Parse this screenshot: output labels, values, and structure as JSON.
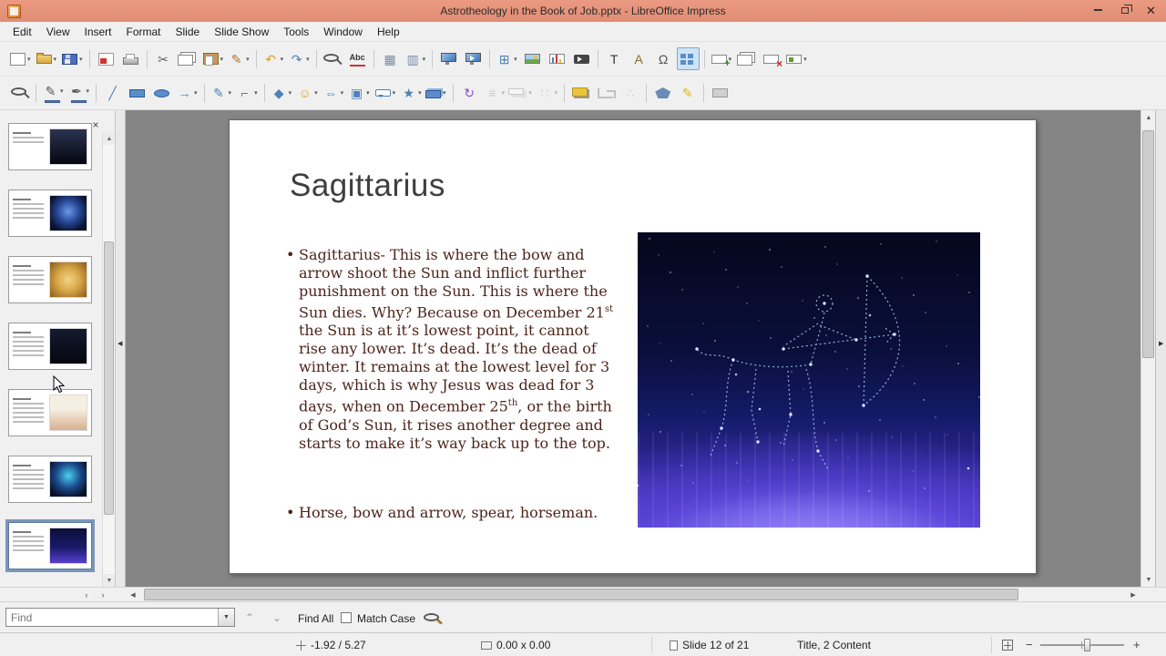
{
  "window": {
    "title": "Astrotheology in the Book of Job.pptx - LibreOffice Impress"
  },
  "menu": {
    "items": [
      "Edit",
      "View",
      "Insert",
      "Format",
      "Slide",
      "Slide Show",
      "Tools",
      "Window",
      "Help"
    ]
  },
  "toolbar1": [
    {
      "n": "new-document",
      "cls": "sh-doc",
      "dd": true
    },
    {
      "n": "open-document",
      "cls": "sh-folder",
      "dd": true
    },
    {
      "n": "save",
      "cls": "sh-floppy",
      "dd": true
    },
    {
      "sep": true
    },
    {
      "n": "export-as-pdf",
      "cls": "sh-pdf"
    },
    {
      "n": "print",
      "cls": "sh-printer"
    },
    {
      "sep": true
    },
    {
      "n": "cut",
      "g": "✂",
      "c": "#666"
    },
    {
      "n": "copy",
      "cls": "sh-copy"
    },
    {
      "n": "paste",
      "cls": "sh-paste",
      "dd": true
    },
    {
      "n": "clone-formatting",
      "g": "✎",
      "c": "#b8742a",
      "dd": true
    },
    {
      "sep": true
    },
    {
      "n": "undo",
      "g": "↶",
      "c": "#d89c2a",
      "dd": true
    },
    {
      "n": "redo",
      "g": "↷",
      "c": "#4d82b8",
      "dd": true
    },
    {
      "sep": true
    },
    {
      "n": "find-and-replace",
      "cls": "sh-zoom"
    },
    {
      "n": "spelling",
      "cls": "sh-spell"
    },
    {
      "sep": true
    },
    {
      "n": "display-grid",
      "g": "▦",
      "c": "#7a8aa8"
    },
    {
      "n": "snap-lines",
      "g": "▥",
      "c": "#7a8aa8",
      "dd": true
    },
    {
      "sep": true
    },
    {
      "n": "start-from-first-slide",
      "cls": "sh-monitor"
    },
    {
      "n": "start-from-current-slide",
      "cls": "sh-monitor2"
    },
    {
      "sep": true
    },
    {
      "n": "insert-table",
      "g": "⊞",
      "c": "#4d82b8",
      "dd": true
    },
    {
      "n": "insert-image",
      "cls": "sh-image"
    },
    {
      "n": "insert-chart",
      "cls": "sh-chart"
    },
    {
      "n": "insert-media",
      "cls": "sh-media"
    },
    {
      "sep": true
    },
    {
      "n": "insert-text-box",
      "g": "T",
      "c": "#333"
    },
    {
      "n": "insert-fontwork",
      "g": "A",
      "c": "#8a6a2a"
    },
    {
      "n": "insert-special-character",
      "g": "Ω",
      "c": "#555"
    },
    {
      "n": "display-views",
      "cls": "sh-views",
      "act": true
    },
    {
      "sep": true
    },
    {
      "n": "new-slide",
      "cls": "sh-slide-plus",
      "dd": true
    },
    {
      "n": "duplicate-slide",
      "cls": "sh-copy"
    },
    {
      "n": "delete-slide",
      "cls": "sh-slide-del"
    },
    {
      "n": "slide-properties",
      "cls": "sh-layout",
      "dd": true
    }
  ],
  "toolbar2": [
    {
      "n": "zoom",
      "cls": "sh-zoom"
    },
    {
      "sep": true
    },
    {
      "n": "line-color",
      "g": "✎",
      "c": "#555",
      "bar": "#4a78c8",
      "dd": true
    },
    {
      "n": "fill-color",
      "g": "✒",
      "c": "#555",
      "bar": "#4a78c8",
      "dd": true
    },
    {
      "sep": true
    },
    {
      "n": "insert-line",
      "g": "╱",
      "c": "#4d82b8"
    },
    {
      "n": "rectangle",
      "cls": "sh-rect"
    },
    {
      "n": "ellipse",
      "cls": "sh-ellipse"
    },
    {
      "n": "lines-and-arrows",
      "g": "→",
      "c": "#4d82b8",
      "dd": true
    },
    {
      "sep": true
    },
    {
      "n": "curves-and-polygons",
      "g": "✎",
      "c": "#4d82b8",
      "dd": true
    },
    {
      "n": "connectors",
      "g": "⌐",
      "c": "#4d82b8",
      "dd": true
    },
    {
      "sep": true
    },
    {
      "n": "basic-shapes",
      "g": "◆",
      "c": "#4d82b8",
      "dd": true
    },
    {
      "n": "symbol-shapes",
      "g": "☺",
      "c": "#d8a72a",
      "dd": true
    },
    {
      "n": "block-arrows",
      "g": "⇔",
      "c": "#4d82b8",
      "dd": true
    },
    {
      "n": "flowchart-shapes",
      "g": "▣",
      "c": "#4d82b8",
      "dd": true
    },
    {
      "n": "callout-shapes",
      "cls": "sh-callout",
      "dd": true
    },
    {
      "n": "stars-and-banners",
      "g": "★",
      "c": "#4d82b8",
      "dd": true
    },
    {
      "n": "3d-objects",
      "cls": "sh-cube",
      "dd": true
    },
    {
      "sep": true
    },
    {
      "n": "rotate",
      "g": "↻",
      "c": "#8a4fc8"
    },
    {
      "n": "align-objects",
      "g": "≡",
      "c": "#888",
      "dd": true,
      "dis": true
    },
    {
      "n": "arrange-objects",
      "cls": "sh-arrange",
      "dd": true,
      "dis": true
    },
    {
      "n": "distribute-objects",
      "g": "∷",
      "c": "#999",
      "dd": true,
      "dis": true
    },
    {
      "sep": true
    },
    {
      "n": "shadow",
      "cls": "sh-shadow"
    },
    {
      "n": "crop-image",
      "cls": "sh-crop",
      "dis": true
    },
    {
      "n": "edit-points",
      "g": "∴",
      "c": "#999",
      "dis": true
    },
    {
      "sep": true
    },
    {
      "n": "polygon",
      "cls": "sh-pentagon"
    },
    {
      "n": "glue-points",
      "g": "✎",
      "c": "#d8b82a"
    },
    {
      "sep": true
    },
    {
      "n": "toggle-extrusion",
      "cls": "sh-gray"
    }
  ],
  "panel": {
    "thumbnails": [
      {
        "img": "img-night",
        "lines": 3
      },
      {
        "img": "img-nebula",
        "lines": 5
      },
      {
        "img": "img-gold",
        "lines": 5
      },
      {
        "img": "img-stars",
        "lines": 6
      },
      {
        "img": "img-scales",
        "lines": 6
      },
      {
        "img": "img-aqua",
        "lines": 6
      },
      {
        "img": "img-saggi",
        "lines": 5,
        "selected": true
      }
    ]
  },
  "slide": {
    "title": "Sagittarius",
    "bullet_char": "•",
    "b1": {
      "t1": "Sagittarius- This is where the bow and arrow shoot the Sun and inflict further punishment on the Sun. This is where the Sun dies. Why? Because on December 21",
      "s1": "st",
      "t2": " the Sun is at it’s lowest point, it cannot rise any lower. It’s dead. It’s the dead of winter. It remains at the lowest level for 3 days, which is why Jesus was dead for 3 days, when on December 25",
      "s2": "th",
      "t3": ", or the birth of God’s Sun, it rises another degree and starts to make it’s way back up to the top."
    },
    "b2": "Horse, bow and arrow, spear, horseman."
  },
  "findbar": {
    "placeholder": "Find",
    "find_all": "Find All",
    "match_case": "Match Case"
  },
  "statusbar": {
    "position": "-1.92 / 5.27",
    "size": "0.00 x 0.00",
    "slide": "Slide 12 of 21",
    "layout": "Title, 2 Content"
  }
}
